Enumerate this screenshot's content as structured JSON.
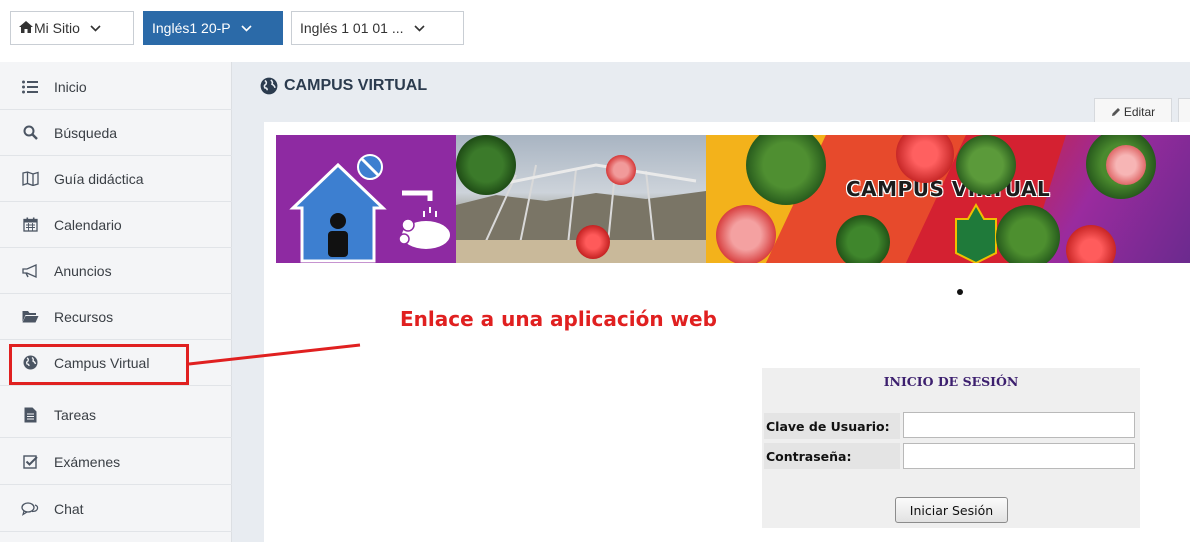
{
  "topbar": {
    "site_label": "Mi Sitio",
    "course_label": "Inglés1 20-P",
    "subject_label": "Inglés 1 01 01 ...",
    "home_icon": "home-icon",
    "chevron_icon": "chevron-down-icon"
  },
  "sidebar": {
    "items": [
      {
        "label": "Inicio",
        "icon": "list-icon"
      },
      {
        "label": "Búsqueda",
        "icon": "search-icon"
      },
      {
        "label": "Guía didáctica",
        "icon": "map-icon"
      },
      {
        "label": "Calendario",
        "icon": "calendar-icon"
      },
      {
        "label": "Anuncios",
        "icon": "megaphone-icon"
      },
      {
        "label": "Recursos",
        "icon": "folder-icon"
      },
      {
        "label": "Campus Virtual",
        "icon": "globe-icon"
      },
      {
        "label": "Tareas",
        "icon": "document-icon"
      },
      {
        "label": "Exámenes",
        "icon": "checkbox-icon"
      },
      {
        "label": "Chat",
        "icon": "chat-icon"
      }
    ]
  },
  "main": {
    "title": "CAMPUS VIRTUAL",
    "edit_label": "Editar",
    "banner_title": "CAMPUS VIRTUAL"
  },
  "annotation": {
    "text": "Enlace a una aplicación web",
    "color": "#e02020"
  },
  "login": {
    "title": "INICIO DE SESIÓN",
    "user_label": "Clave de Usuario:",
    "password_label": "Contraseña:",
    "user_value": "",
    "password_value": "",
    "submit_label": "Iniciar Sesión"
  },
  "colors": {
    "accent": "#2b6aa8",
    "title": "#2b3b4e",
    "login_title": "#3c1f6e"
  }
}
